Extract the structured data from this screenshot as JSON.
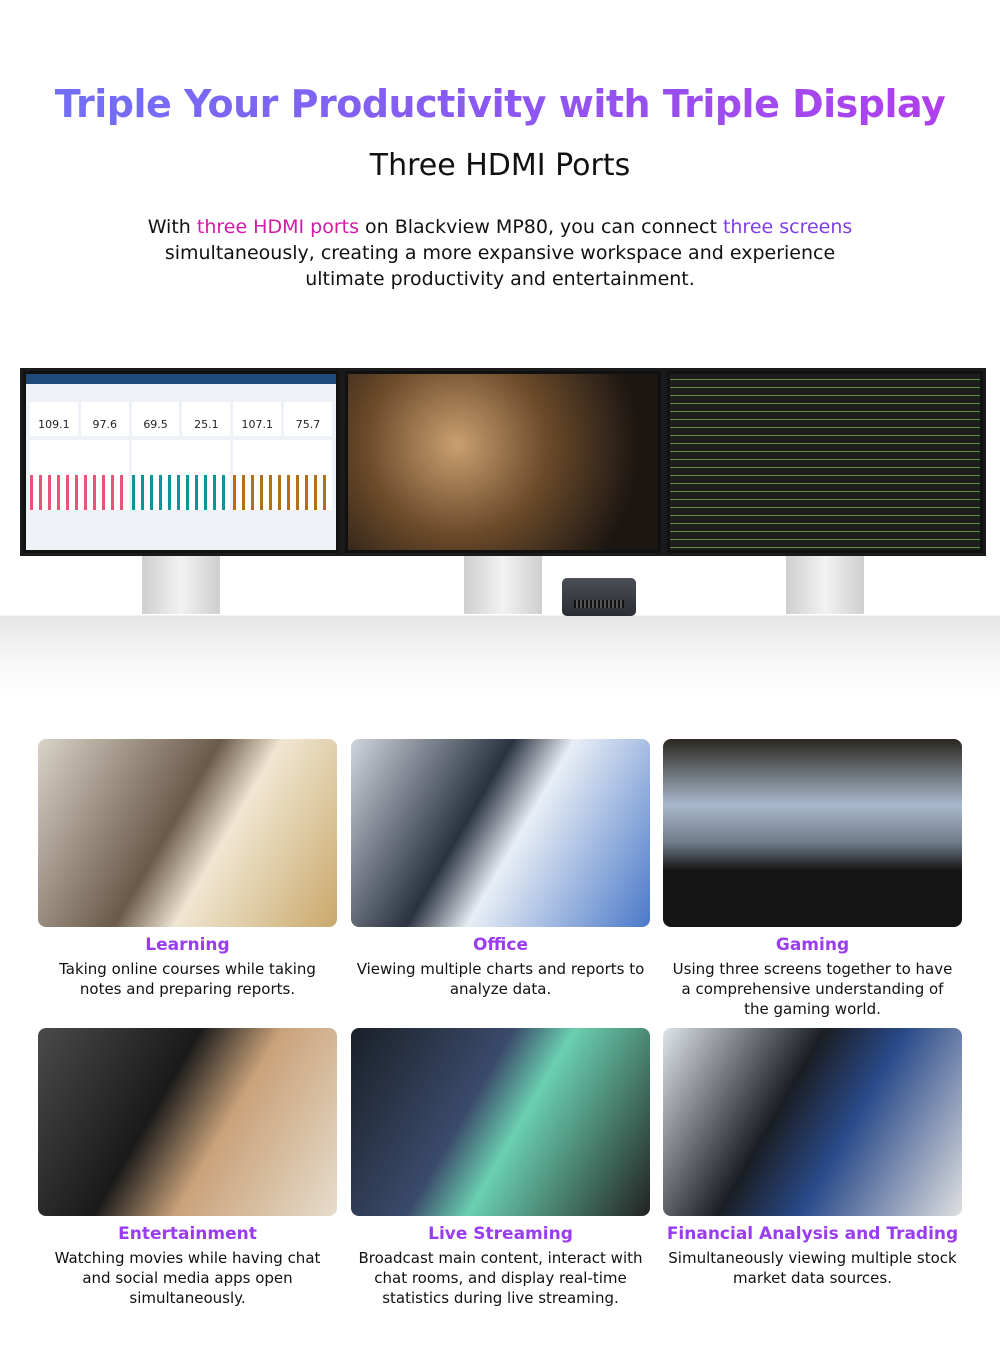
{
  "header": {
    "title": "Triple Your Productivity with Triple Display",
    "subtitle": "Three HDMI Ports",
    "intro": {
      "p1": "With ",
      "h1": "three HDMI ports",
      "p2": " on Blackview MP80, you can connect ",
      "h2": "three screens",
      "p3": " simultaneously, creating a more expansive workspace and experience ultimate productivity and entertainment."
    }
  },
  "dashboard": {
    "kpis": [
      "109.1",
      "97.6",
      "69.5",
      "25.1",
      "107.1",
      "75.7"
    ]
  },
  "colors": {
    "title_gradient": [
      "#6e72f6",
      "#b53cec"
    ],
    "highlight1": "#d11aa8",
    "highlight2": "#7f3de8",
    "card_title": "#9a3cf0"
  },
  "cards": [
    {
      "title": "Learning",
      "desc": "Taking online courses while taking notes and preparing reports.",
      "bg": "linear-gradient(120deg,#d9d3c8,#6b5a4a 45%,#f0e6d2 60%,#c9a86a)"
    },
    {
      "title": "Office",
      "desc": "Viewing multiple charts and reports to analyze data.",
      "bg": "linear-gradient(120deg,#cfd6de,#2a3240 40%,#e8eef5 55%,#4a78c8)"
    },
    {
      "title": "Gaming",
      "desc": "Using three screens together to have a comprehensive understanding of the gaming world.",
      "bg": "linear-gradient(#2a2620,#a9b8cc 35%,#6f7c8a 55%,#151515 70%)"
    },
    {
      "title": "Entertainment",
      "desc": "Watching movies while having chat and social media apps open simultaneously.",
      "bg": "linear-gradient(120deg,#4a4a4a,#1a1a1a 40%,#c9a27a 60%,#e7dccc)"
    },
    {
      "title": "Live Streaming",
      "desc": "Broadcast main content, interact with chat rooms, and display real-time statistics during live streaming.",
      "bg": "linear-gradient(120deg,#1a2028,#3a4a6a 40%,#6ad0b0 55%,#222)"
    },
    {
      "title": "Financial Analysis and Trading",
      "desc": "Simultaneously viewing multiple stock market data sources.",
      "bg": "linear-gradient(120deg,#dfe4ea,#1a1e24 40%,#2a4a8a 60%,#e0e0e0)"
    }
  ]
}
